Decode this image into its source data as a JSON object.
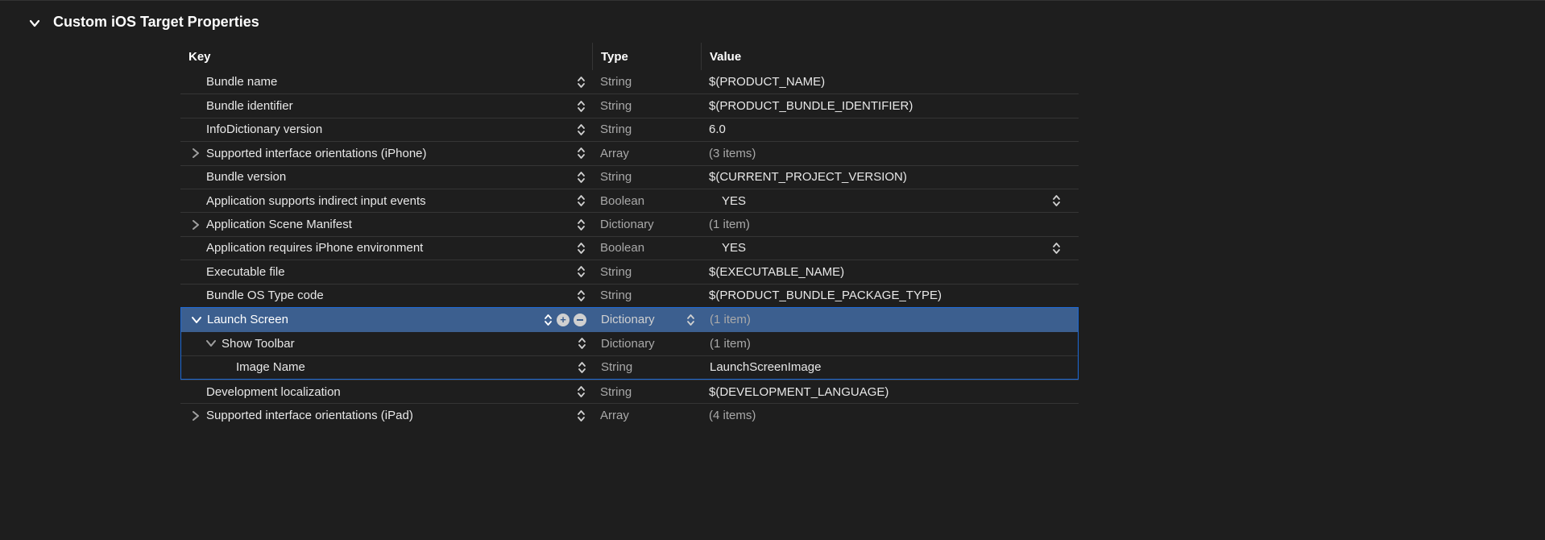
{
  "section": {
    "title": "Custom iOS Target Properties",
    "expanded": true
  },
  "columns": {
    "key": "Key",
    "type": "Type",
    "value": "Value"
  },
  "rows": [
    {
      "key": "Bundle name",
      "type": "String",
      "value": "$(PRODUCT_NAME)",
      "indent": 0,
      "disclosure": "none",
      "selected": false,
      "value_dim": false,
      "value_updown": false
    },
    {
      "key": "Bundle identifier",
      "type": "String",
      "value": "$(PRODUCT_BUNDLE_IDENTIFIER)",
      "indent": 0,
      "disclosure": "none",
      "selected": false,
      "value_dim": false,
      "value_updown": false
    },
    {
      "key": "InfoDictionary version",
      "type": "String",
      "value": "6.0",
      "indent": 0,
      "disclosure": "none",
      "selected": false,
      "value_dim": false,
      "value_updown": false
    },
    {
      "key": "Supported interface orientations (iPhone)",
      "type": "Array",
      "value": "(3 items)",
      "indent": 0,
      "disclosure": "closed",
      "selected": false,
      "value_dim": true,
      "value_updown": false
    },
    {
      "key": "Bundle version",
      "type": "String",
      "value": "$(CURRENT_PROJECT_VERSION)",
      "indent": 0,
      "disclosure": "none",
      "selected": false,
      "value_dim": false,
      "value_updown": false
    },
    {
      "key": "Application supports indirect input events",
      "type": "Boolean",
      "value": "YES",
      "indent": 0,
      "disclosure": "none",
      "selected": false,
      "value_dim": false,
      "value_updown": true,
      "value_bool": true
    },
    {
      "key": "Application Scene Manifest",
      "type": "Dictionary",
      "value": "(1 item)",
      "indent": 0,
      "disclosure": "closed",
      "selected": false,
      "value_dim": true,
      "value_updown": false
    },
    {
      "key": "Application requires iPhone environment",
      "type": "Boolean",
      "value": "YES",
      "indent": 0,
      "disclosure": "none",
      "selected": false,
      "value_dim": false,
      "value_updown": true,
      "value_bool": true
    },
    {
      "key": "Executable file",
      "type": "String",
      "value": "$(EXECUTABLE_NAME)",
      "indent": 0,
      "disclosure": "none",
      "selected": false,
      "value_dim": false,
      "value_updown": false
    },
    {
      "key": "Bundle OS Type code",
      "type": "String",
      "value": "$(PRODUCT_BUNDLE_PACKAGE_TYPE)",
      "indent": 0,
      "disclosure": "none",
      "selected": false,
      "value_dim": false,
      "value_updown": false
    },
    {
      "key": "Launch Screen",
      "type": "Dictionary",
      "value": "(1 item)",
      "indent": 0,
      "disclosure": "open",
      "selected": true,
      "value_dim": true,
      "value_updown": false,
      "show_addremove": true,
      "show_type_updown": true
    },
    {
      "key": "Show Toolbar",
      "type": "Dictionary",
      "value": "(1 item)",
      "indent": 1,
      "disclosure": "open",
      "selected": false,
      "value_dim": true,
      "value_updown": false,
      "in_focus": true
    },
    {
      "key": "Image Name",
      "type": "String",
      "value": "LaunchScreenImage",
      "indent": 2,
      "disclosure": "none",
      "selected": false,
      "value_dim": false,
      "value_updown": false,
      "in_focus": true
    },
    {
      "key": "Development localization",
      "type": "String",
      "value": "$(DEVELOPMENT_LANGUAGE)",
      "indent": 0,
      "disclosure": "none",
      "selected": false,
      "value_dim": false,
      "value_updown": false
    },
    {
      "key": "Supported interface orientations (iPad)",
      "type": "Array",
      "value": "(4 items)",
      "indent": 0,
      "disclosure": "closed",
      "selected": false,
      "value_dim": true,
      "value_updown": false
    }
  ],
  "icons": {
    "chevron_down": "chevron-down-icon",
    "chevron_right": "chevron-right-icon",
    "updown": "updown-icon",
    "add": "add-icon",
    "remove": "remove-icon"
  }
}
